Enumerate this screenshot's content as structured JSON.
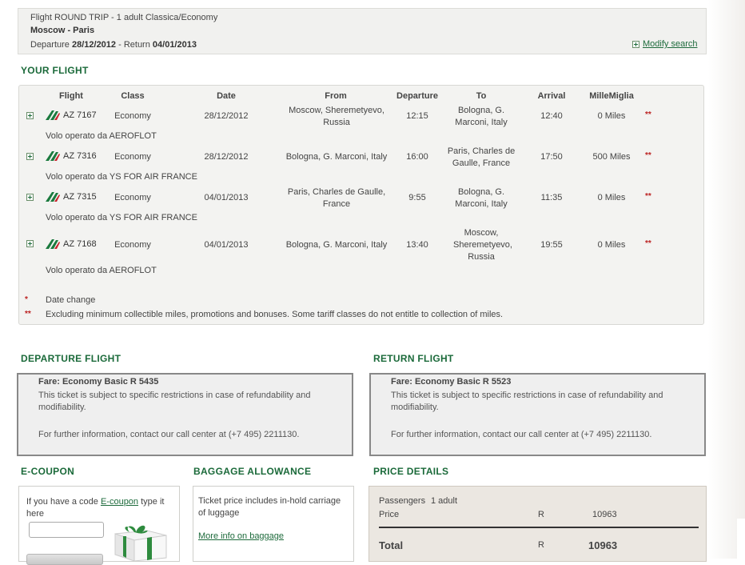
{
  "summary": {
    "trip_line": "Flight ROUND TRIP - 1 adult  Classica/Economy",
    "route": "Moscow - Paris",
    "departure_label": "Departure",
    "departure_date": "28/12/2012",
    "return_label": " - Return ",
    "return_date": "04/01/2013",
    "modify_label": "Modify search"
  },
  "your_flight": {
    "title": "YOUR FLIGHT",
    "headers": {
      "flight": "Flight",
      "class": "Class",
      "date": "Date",
      "from": "From",
      "departure": "Departure",
      "to": "To",
      "arrival": "Arrival",
      "miles": "MilleMiglia"
    },
    "rows": [
      {
        "flight": "AZ 7167",
        "class": "Economy",
        "date": "28/12/2012",
        "from": "Moscow, Sheremetyevo, Russia",
        "departure": "12:15",
        "to": "Bologna, G. Marconi, Italy",
        "arrival": "12:40",
        "miles": "0 Miles",
        "stars": "**",
        "operated": "Volo operato da AEROFLOT"
      },
      {
        "flight": "AZ 7316",
        "class": "Economy",
        "date": "28/12/2012",
        "from": "Bologna, G. Marconi, Italy",
        "departure": "16:00",
        "to": "Paris, Charles de Gaulle, France",
        "arrival": "17:50",
        "miles": "500 Miles",
        "stars": "**",
        "operated": "Volo operato da YS FOR AIR FRANCE"
      },
      {
        "flight": "AZ 7315",
        "class": "Economy",
        "date": "04/01/2013",
        "from": "Paris, Charles de Gaulle, France",
        "departure": "9:55",
        "to": "Bologna, G. Marconi, Italy",
        "arrival": "11:35",
        "miles": "0 Miles",
        "stars": "**",
        "operated": "Volo operato da YS FOR AIR FRANCE"
      },
      {
        "flight": "AZ 7168",
        "class": "Economy",
        "date": "04/01/2013",
        "from": "Bologna, G. Marconi, Italy",
        "departure": "13:40",
        "to": "Moscow, Sheremetyevo, Russia",
        "arrival": "19:55",
        "miles": "0 Miles",
        "stars": "**",
        "operated": "Volo operato da AEROFLOT"
      }
    ],
    "notes": [
      {
        "mark": "*",
        "text": "Date change"
      },
      {
        "mark": "**",
        "text": "Excluding minimum collectible miles, promotions and bonuses. Some tariff classes do not entitle to collection of miles."
      }
    ]
  },
  "departure_flight": {
    "title": "DEPARTURE FLIGHT",
    "fare": "Fare: Economy Basic R 5435",
    "restrictions": "This ticket is subject to specific restrictions in case of refundability and modifiability.",
    "call_center": "For further information, contact our call center at (+7 495) 2211130."
  },
  "return_flight": {
    "title": "RETURN FLIGHT",
    "fare": "Fare: Economy Basic R 5523",
    "restrictions": "This ticket is subject to specific restrictions in case of refundability and modifiability.",
    "call_center": "For further information, contact our call center at (+7 495) 2211130."
  },
  "ecoupon": {
    "title": "E-COUPON",
    "text_before": "If you have a code ",
    "link": "E-coupon",
    "text_after": " type it here",
    "input_value": ""
  },
  "baggage": {
    "title": "BAGGAGE ALLOWANCE",
    "text": "Ticket price includes in-hold carriage of luggage",
    "link": "More info on baggage"
  },
  "price_details": {
    "title": "PRICE DETAILS",
    "passengers_label": "Passengers",
    "passengers_value": "1 adult",
    "price_label": "Price",
    "price_currency": "R",
    "price_value": "10963",
    "total_label": "Total",
    "total_currency": "R",
    "total_value": "10963"
  },
  "colors": {
    "accent_green": "#1b6a3a",
    "alert_red": "#bb2222",
    "panel_bg": "#f3f3f1"
  }
}
